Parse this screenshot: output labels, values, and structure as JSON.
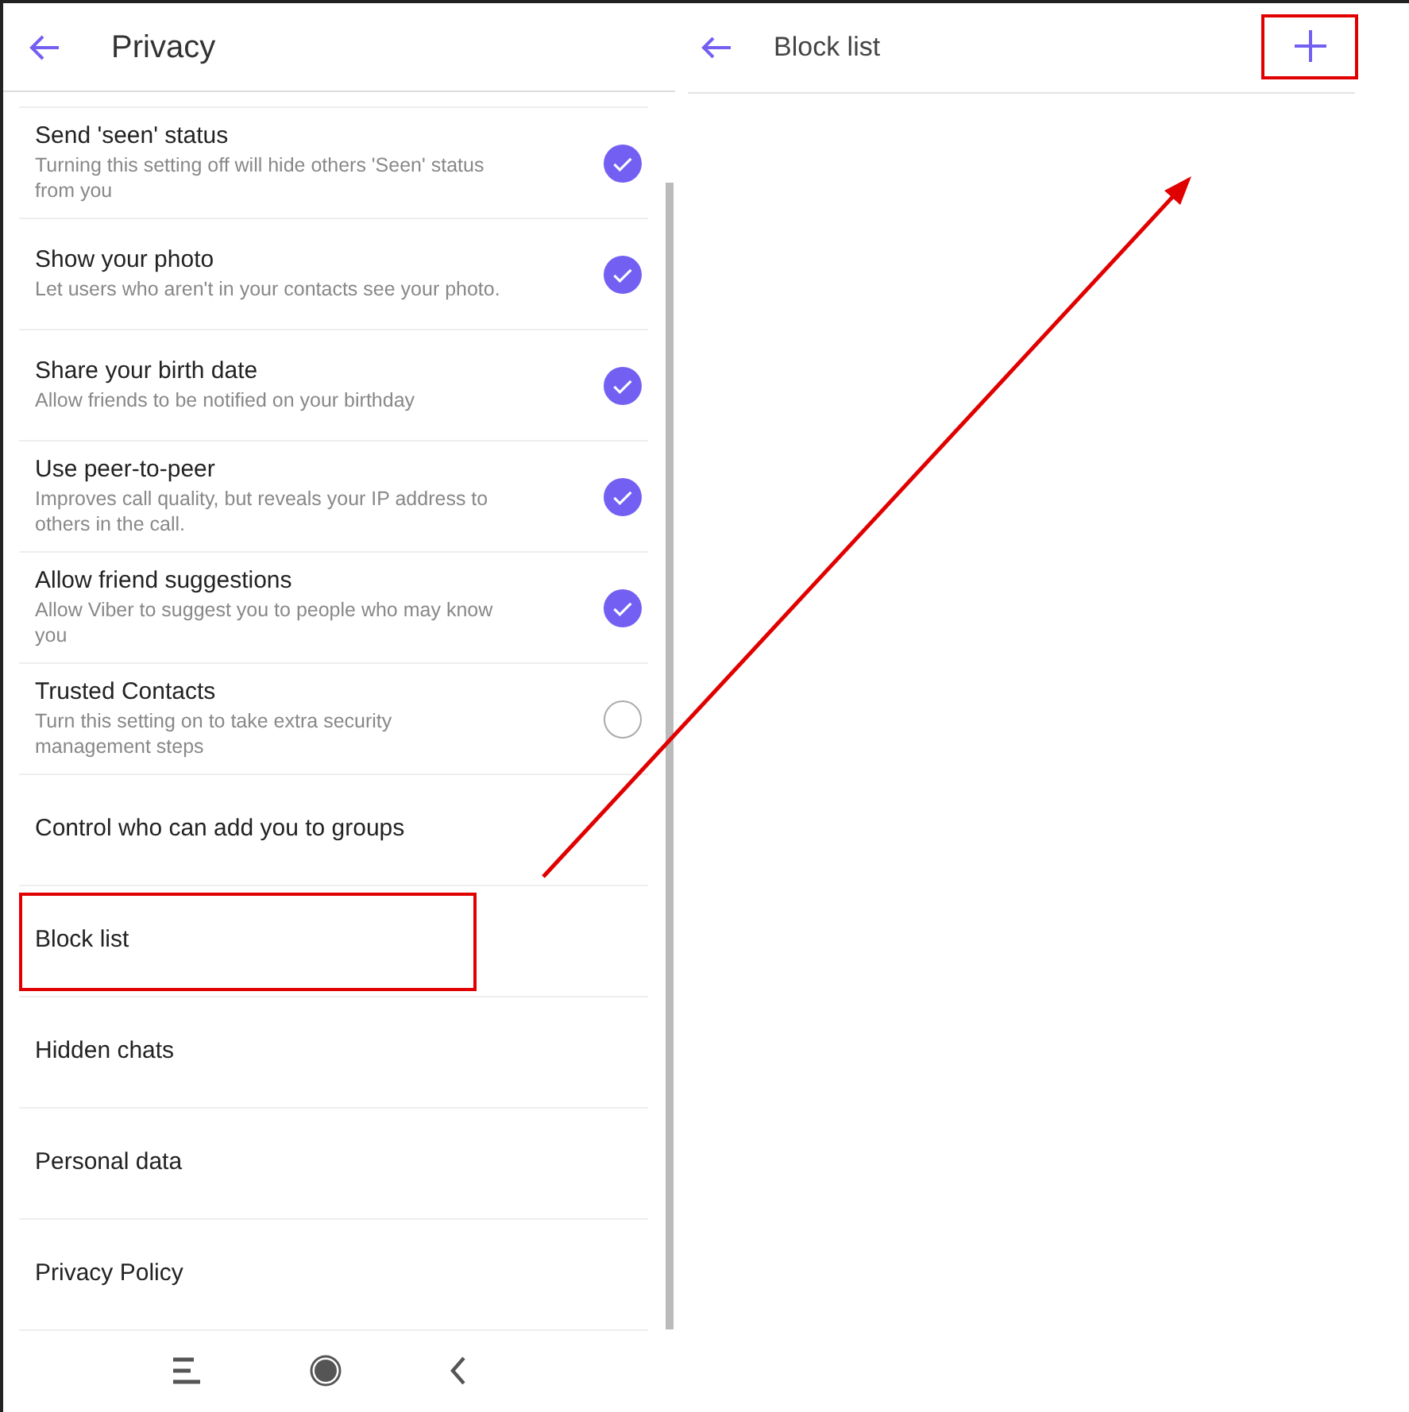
{
  "privacy_screen": {
    "title": "Privacy",
    "items": [
      {
        "kind": "toggle",
        "title": "Send 'seen' status",
        "subtitle": "Turning this setting off will hide others 'Seen' status from you",
        "checked": true
      },
      {
        "kind": "toggle",
        "title": "Show your photo",
        "subtitle": "Let users who aren't in your contacts see your photo.",
        "checked": true
      },
      {
        "kind": "toggle",
        "title": "Share your birth date",
        "subtitle": "Allow friends to be notified on your birthday",
        "checked": true
      },
      {
        "kind": "toggle",
        "title": "Use peer-to-peer",
        "subtitle": "Improves call quality, but reveals your IP address to others in the call.",
        "checked": true
      },
      {
        "kind": "toggle",
        "title": "Allow friend suggestions",
        "subtitle": "Allow Viber to suggest you to people who may know you",
        "checked": true
      },
      {
        "kind": "toggle",
        "title": "Trusted Contacts",
        "subtitle": "Turn this setting on to take extra security management steps",
        "checked": false
      },
      {
        "kind": "link",
        "title": "Control who can add you to groups",
        "highlighted": false
      },
      {
        "kind": "link",
        "title": "Block list",
        "highlighted": true
      },
      {
        "kind": "link",
        "title": "Hidden chats",
        "highlighted": false
      },
      {
        "kind": "link",
        "title": "Personal data",
        "highlighted": false
      },
      {
        "kind": "link",
        "title": "Privacy Policy",
        "highlighted": false
      }
    ]
  },
  "block_list_screen": {
    "title": "Block list",
    "add_button_highlighted": true
  }
}
